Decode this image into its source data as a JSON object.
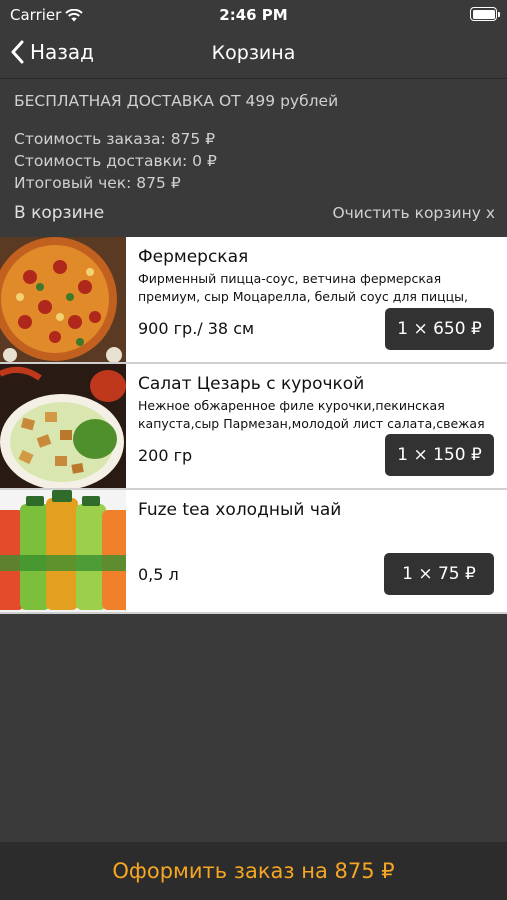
{
  "status_bar": {
    "carrier": "Carrier",
    "time": "2:46 PM",
    "battery_level": 1.0
  },
  "nav": {
    "back_label": "Назад",
    "title": "Корзина"
  },
  "summary": {
    "promo": "БЕСПЛАТНАЯ ДОСТАВКА ОТ 499 рублей",
    "order_cost": "Стоимость заказа: 875 ₽",
    "delivery_cost": "Стоимость доставки: 0 ₽",
    "total": "Итоговый чек: 875 ₽"
  },
  "cart": {
    "label": "В корзине",
    "clear_label": "Очистить корзину x",
    "items": [
      {
        "name": "Фермерская",
        "description": "Фирменный пицца-соус, ветчина  фермерская премиум, сыр Моцарелла, белый соус для пиццы, перец  болгар...",
        "size": "900 гр./ 38 см",
        "price": "1 × 650 ₽"
      },
      {
        "name": "Салат Цезарь с курочкой",
        "description": "Нежное обжаренное филе курочки,пекинская капуста,сыр Пармезан,молодой лист салата,свежая з...",
        "size": "200 гр",
        "price": "1 × 150 ₽"
      },
      {
        "name": "Fuze tea холодный чай",
        "description": "",
        "size": "0,5 л",
        "price": "1 × 75 ₽"
      }
    ]
  },
  "checkout": {
    "label": "Оформить заказ на 875 ₽"
  },
  "colors": {
    "background": "#3a3a3a",
    "accent": "#f5a623",
    "button": "#323232"
  }
}
